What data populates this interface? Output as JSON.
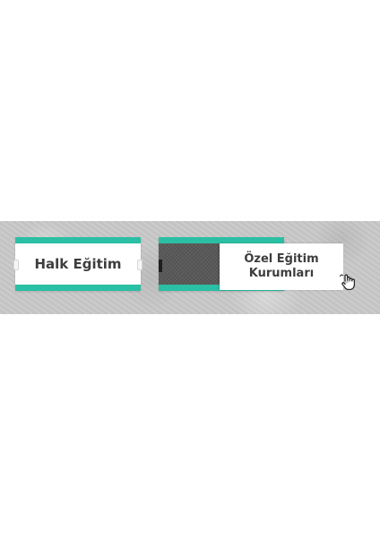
{
  "left_sign": {
    "label": "Halk Eğitim"
  },
  "right_sign": {
    "line1": "Özel Eğitim",
    "line2": "Kurumları"
  },
  "colors": {
    "teal_stripe": "#2bbfa4",
    "text": "#3d3d3d",
    "slider_track": "#5a5a5a"
  },
  "icons": {
    "cursor": "hand-swipe-icon"
  }
}
